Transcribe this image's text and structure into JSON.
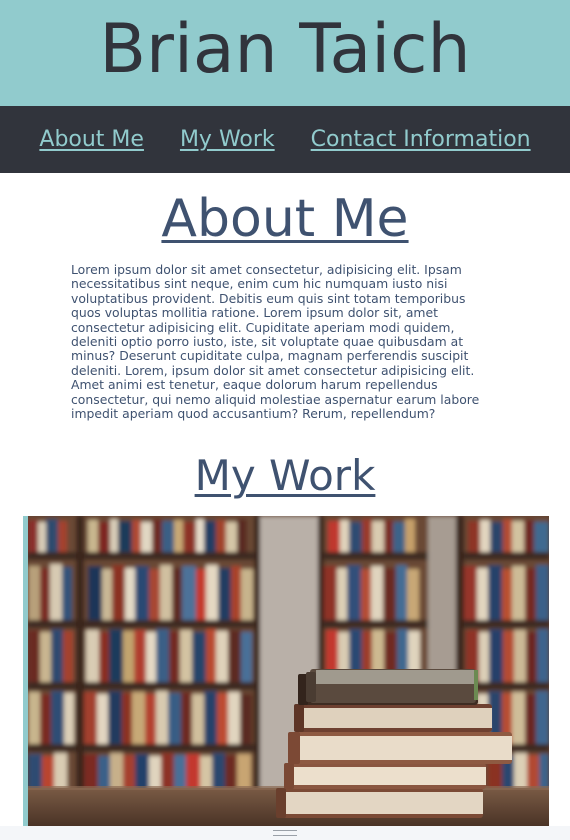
{
  "header": {
    "title": "Brian Taich",
    "background": "#91cbcd",
    "text_color": "#31343c"
  },
  "nav": {
    "background": "#31343c",
    "link_color": "#91cbcd",
    "items": [
      {
        "label": "About Me"
      },
      {
        "label": "My Work"
      },
      {
        "label": "Contact Information"
      }
    ]
  },
  "about": {
    "heading": "About Me",
    "body": "Lorem ipsum dolor sit amet consectetur, adipisicing elit. Ipsam necessitatibus sint neque, enim cum hic numquam iusto nisi voluptatibus provident. Debitis eum quis sint totam temporibus quos voluptas mollitia ratione. Lorem ipsum dolor sit, amet consectetur adipisicing elit. Cupiditate aperiam modi quidem, deleniti optio porro iusto, iste, sit voluptate quae quibusdam at minus? Deserunt cupiditate culpa, magnam perferendis suscipit deleniti. Lorem, ipsum dolor sit amet consectetur adipisicing elit. Amet animi est tenetur, eaque dolorum harum repellendus consectetur, qui nemo aliquid molestiae aspernatur earum labore impedit aperiam quod accusantium? Rerum, repellendum?"
  },
  "work": {
    "heading": "My Work",
    "image_icon": "bookshelf-photo"
  },
  "colors": {
    "accent": "#91cbcd",
    "dark": "#31343c",
    "heading": "#3f5270"
  }
}
